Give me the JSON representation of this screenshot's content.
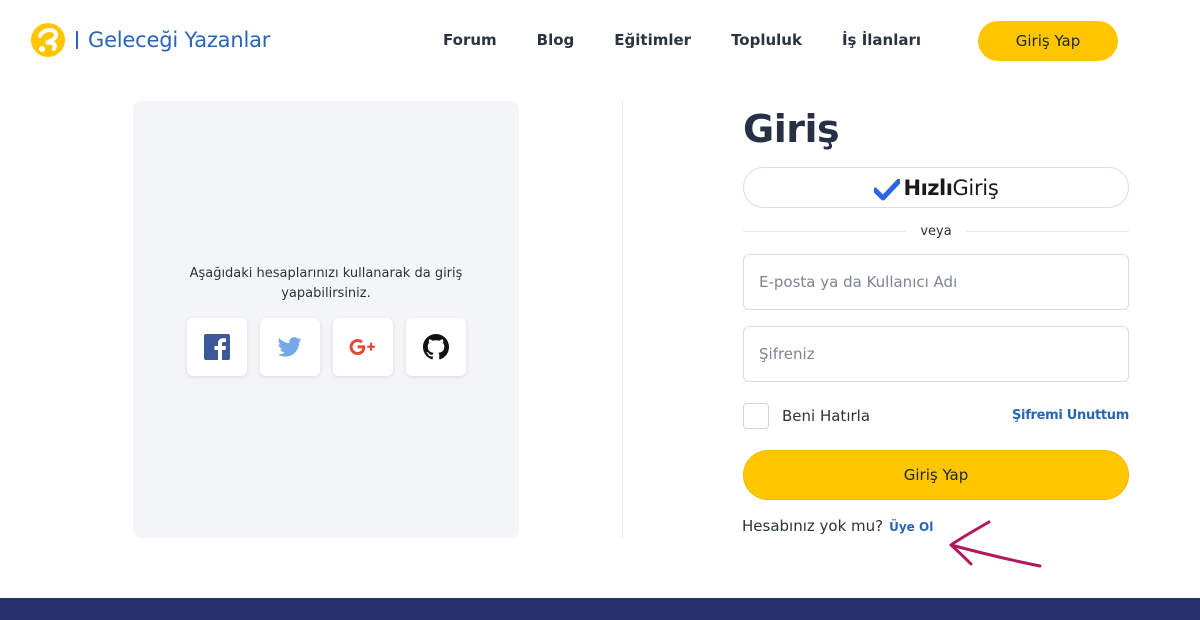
{
  "header": {
    "logo_text": "Geleceği Yazanlar",
    "nav": [
      "Forum",
      "Blog",
      "Eğitimler",
      "Topluluk",
      "İş İlanları"
    ],
    "login_label": "Giriş Yap"
  },
  "social": {
    "text": "Aşağıdaki hesaplarınızı kullanarak da giriş yapabilirsiniz.",
    "providers": [
      "facebook-icon",
      "twitter-icon",
      "google-plus-icon",
      "github-icon"
    ]
  },
  "form": {
    "title": "Giriş",
    "quick_login_bold": "Hızlı",
    "quick_login_light": "Giriş",
    "or_text": "veya",
    "email_placeholder": "E-posta ya da Kullanıcı Adı",
    "password_placeholder": "Şifreniz",
    "remember_label": "Beni Hatırla",
    "forgot_label": "Şifremi Unuttum",
    "submit_label": "Giriş Yap",
    "signup_question": "Hesabınız yok mu?",
    "signup_link": "Üye Ol"
  },
  "colors": {
    "accent": "#ffc600",
    "link": "#2a65b5",
    "footer": "#252f6b",
    "annotation": "#b5175f"
  }
}
